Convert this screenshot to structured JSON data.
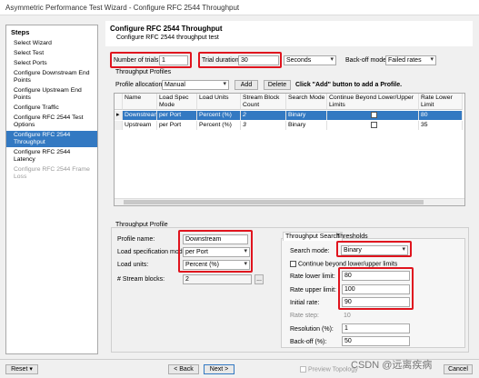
{
  "window_title": "Asymmetric Performance Test Wizard - Configure RFC 2544 Throughput",
  "sidebar": {
    "header": "Steps",
    "items": [
      {
        "label": "Select Wizard",
        "state": "normal"
      },
      {
        "label": "Select Test",
        "state": "normal"
      },
      {
        "label": "Select Ports",
        "state": "normal"
      },
      {
        "label": "Configure Downstream End Points",
        "state": "normal"
      },
      {
        "label": "Configure Upstream End Points",
        "state": "normal"
      },
      {
        "label": "Configure Traffic",
        "state": "normal"
      },
      {
        "label": "Configure RFC 2544 Test Options",
        "state": "normal"
      },
      {
        "label": "Configure RFC 2544 Throughput",
        "state": "active"
      },
      {
        "label": "Configure RFC 2544 Latency",
        "state": "normal"
      },
      {
        "label": "Configure RFC 2544 Frame Loss",
        "state": "disabled"
      }
    ]
  },
  "header": {
    "title": "Configure RFC 2544 Throughput",
    "subtitle": "Configure RFC 2544 throughput test"
  },
  "top": {
    "trials_label": "Number of trials:",
    "trials_value": "1",
    "duration_label": "Trial duration:",
    "duration_value": "30",
    "duration_unit": "Seconds",
    "backoff_label": "Back-off mode:",
    "backoff_value": "Failed rates"
  },
  "profiles": {
    "section": "Throughput Profiles",
    "allocation_label": "Profile allocation:",
    "allocation_value": "Manual",
    "add_label": "Add",
    "delete_label": "Delete",
    "hint": "Click \"Add\" button to add a Profile.",
    "columns": [
      "Name",
      "Load Spec Mode",
      "Load Units",
      "Stream Block Count",
      "Search Mode",
      "Continue Beyond Lower/Upper Limits",
      "Rate Lower Limit"
    ],
    "rows": [
      {
        "name": "Downstream",
        "mode": "per Port",
        "units": "Percent (%)",
        "count": "2",
        "search": "Binary",
        "lower": "80",
        "selected": true
      },
      {
        "name": "Upstream",
        "mode": "per Port",
        "units": "Percent (%)",
        "count": "3",
        "search": "Binary",
        "lower": "35",
        "selected": false
      }
    ]
  },
  "profile": {
    "section": "Throughput Profile",
    "name_label": "Profile name:",
    "name_value": "Downstream",
    "load_spec_label": "Load specification mode:",
    "load_spec_value": "per Port",
    "load_units_label": "Load units:",
    "load_units_value": "Percent (%)",
    "blocks_label": "# Stream blocks:",
    "blocks_value": "2",
    "browse_label": "..."
  },
  "search": {
    "tab1": "Throughput Search",
    "tab2": "Thresholds",
    "mode_label": "Search mode:",
    "mode_value": "Binary",
    "continue_label": "Continue beyond lower/upper limits",
    "lower_label": "Rate lower limit:",
    "lower_value": "80",
    "upper_label": "Rate upper limit:",
    "upper_value": "100",
    "initial_label": "Initial rate:",
    "initial_value": "90",
    "step_label": "Rate step:",
    "step_value": "10",
    "resolution_label": "Resolution (%):",
    "resolution_value": "1",
    "backoff_label": "Back-off (%):",
    "backoff_value": "50"
  },
  "footer": {
    "reset": "Reset",
    "back": "< Back",
    "next": "Next >",
    "preview": "Preview Topology",
    "cancel": "Cancel"
  },
  "watermark": "CSDN @远离疾病"
}
